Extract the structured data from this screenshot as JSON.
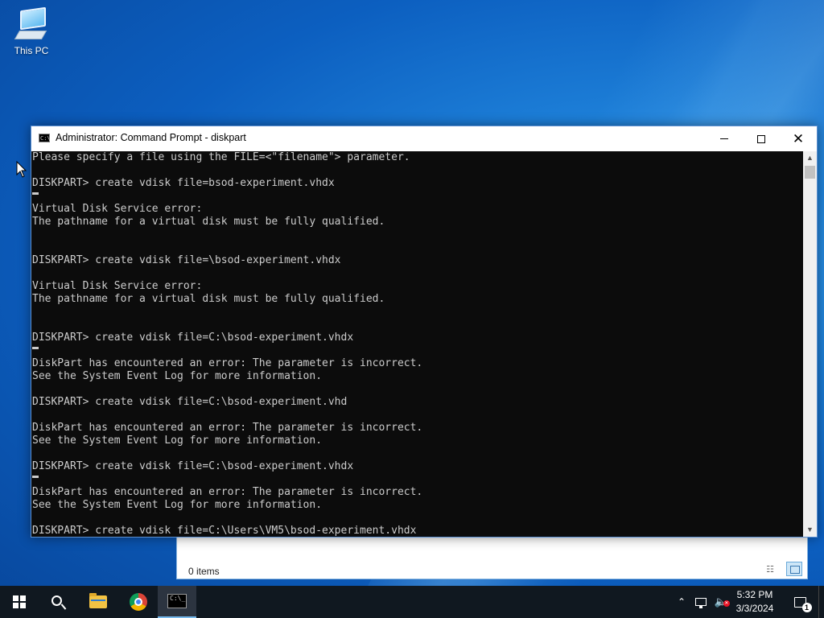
{
  "desktop": {
    "icons": [
      {
        "label": "This PC",
        "icon": "this-pc-icon"
      }
    ]
  },
  "explorer": {
    "status": "0 items"
  },
  "cmd": {
    "title": "Administrator: Command Prompt - diskpart",
    "lines": [
      "Please specify a file using the FILE=<\"filename\"> parameter.",
      "",
      "DISKPART> create vdisk file=bsod-experiment.vhdx",
      "",
      "Virtual Disk Service error:",
      "The pathname for a virtual disk must be fully qualified.",
      "",
      "",
      "DISKPART> create vdisk file=\\bsod-experiment.vhdx",
      "",
      "Virtual Disk Service error:",
      "The pathname for a virtual disk must be fully qualified.",
      "",
      "",
      "DISKPART> create vdisk file=C:\\bsod-experiment.vhdx",
      "",
      "DiskPart has encountered an error: The parameter is incorrect.",
      "See the System Event Log for more information.",
      "",
      "DISKPART> create vdisk file=C:\\bsod-experiment.vhd",
      "",
      "DiskPart has encountered an error: The parameter is incorrect.",
      "See the System Event Log for more information.",
      "",
      "DISKPART> create vdisk file=C:\\bsod-experiment.vhdx",
      "",
      "DiskPart has encountered an error: The parameter is incorrect.",
      "See the System Event Log for more information.",
      "",
      "DISKPART> create vdisk file=C:\\Users\\VM5\\bsod-experiment.vhdx"
    ],
    "colors": {
      "background": "#0c0c0c",
      "text": "#cccccc"
    }
  },
  "taskbar": {
    "items": [
      "start-icon",
      "search-icon",
      "file-explorer-icon",
      "chrome-icon",
      "command-prompt-icon"
    ],
    "active": "command-prompt-icon",
    "tray": {
      "time": "5:32 PM",
      "date": "3/3/2024",
      "notification_count": "1"
    }
  }
}
